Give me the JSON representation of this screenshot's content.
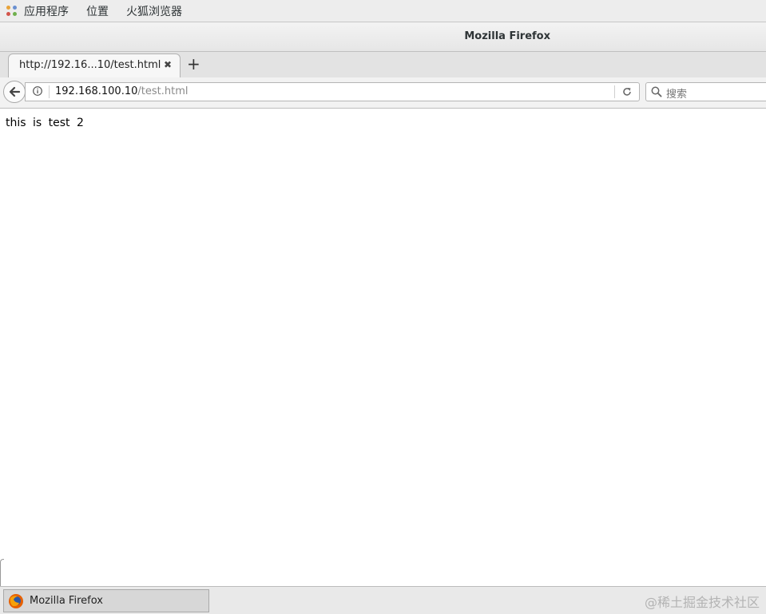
{
  "topbar": {
    "menus": [
      "应用程序",
      "位置",
      "火狐浏览器"
    ]
  },
  "window": {
    "title": "Mozilla Firefox"
  },
  "tabs": [
    {
      "label": "http://192.16...10/test.html",
      "close_glyph": "✖"
    }
  ],
  "newtab_glyph": "+",
  "address": {
    "host": "192.168.100.10",
    "path": "/test.html"
  },
  "search": {
    "placeholder": "搜索"
  },
  "page": {
    "body_text": "this is test 2"
  },
  "taskbar": {
    "item_label": "Mozilla Firefox",
    "watermark": "@稀土掘金技术社区"
  },
  "icons": {
    "apps": "apps-icon",
    "back": "back-arrow-icon",
    "info": "info-icon",
    "reload": "reload-icon",
    "search": "search-icon",
    "firefox": "firefox-icon"
  }
}
